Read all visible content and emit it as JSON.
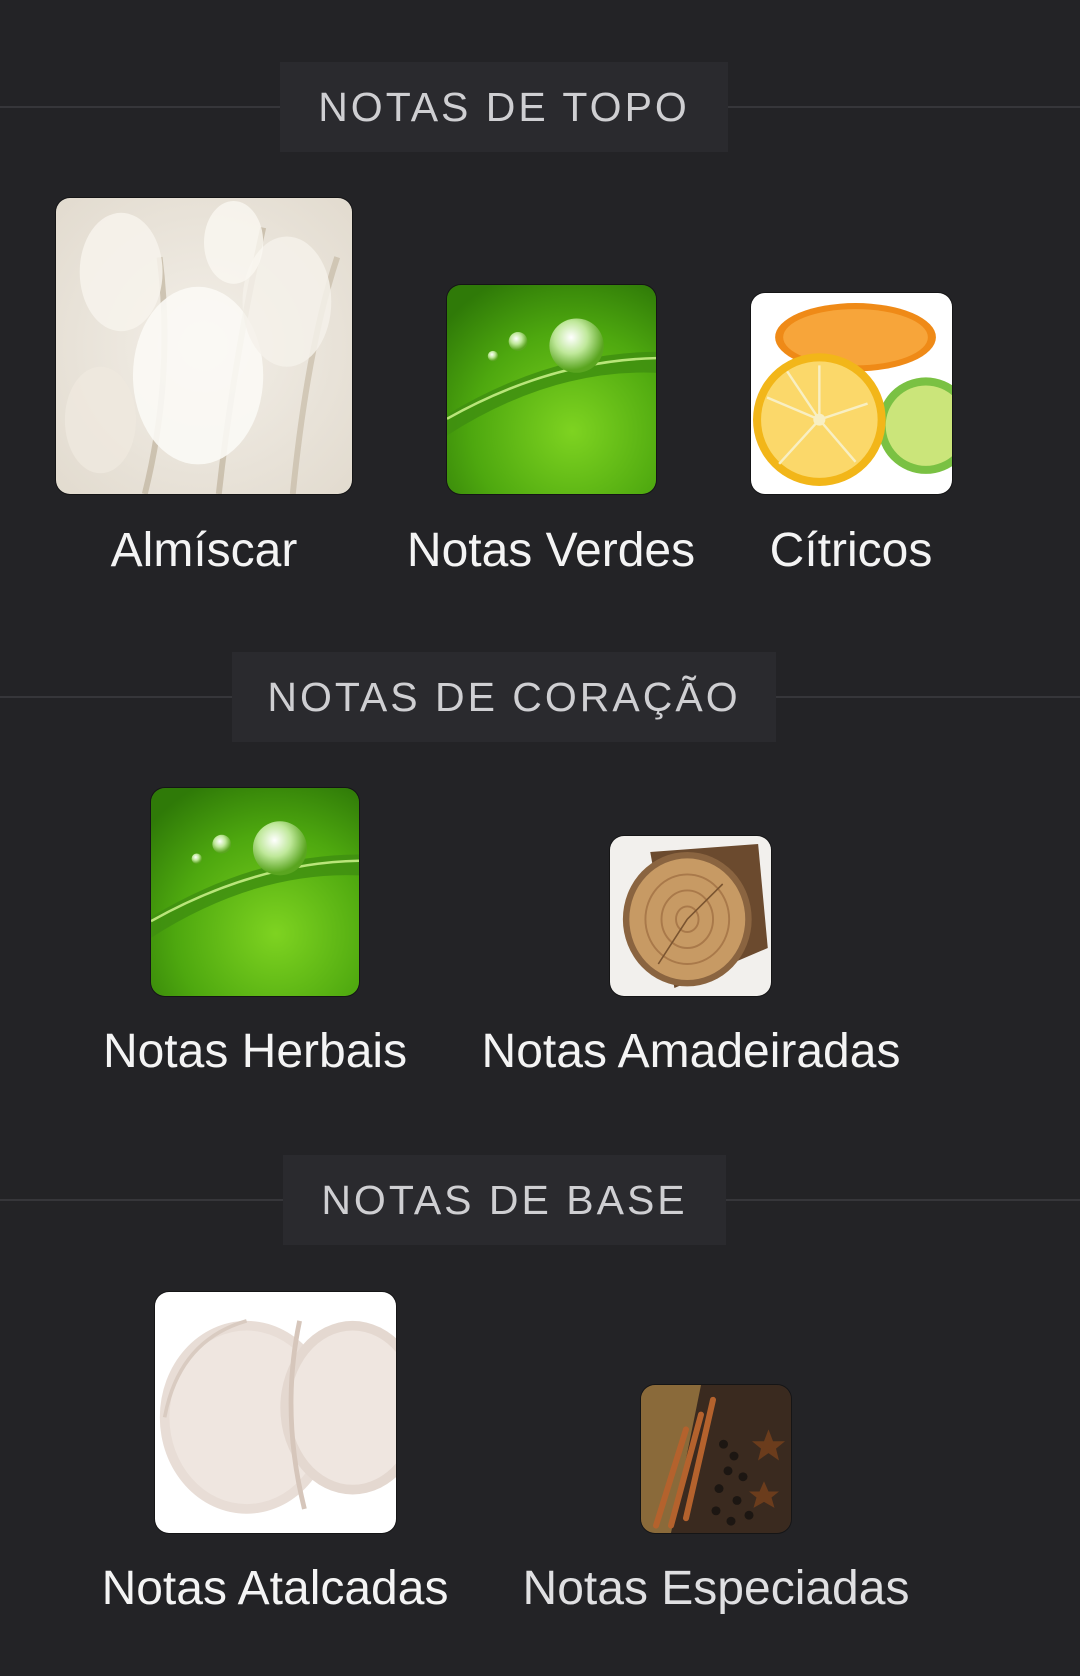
{
  "sections": [
    {
      "title": "NOTAS DE TOPO",
      "notes": [
        {
          "name": "Almíscar",
          "icon": "musk-fluffy-icon"
        },
        {
          "name": "Notas Verdes",
          "icon": "green-leaf-droplet-icon"
        },
        {
          "name": "Cítricos",
          "icon": "citrus-slices-icon"
        }
      ]
    },
    {
      "title": "NOTAS DE CORAÇÃO",
      "notes": [
        {
          "name": "Notas Herbais",
          "icon": "herbal-leaf-droplet-icon"
        },
        {
          "name": "Notas Amadeiradas",
          "icon": "wood-log-icon"
        }
      ]
    },
    {
      "title": "NOTAS DE BASE",
      "notes": [
        {
          "name": "Notas Atalcadas",
          "icon": "powder-icon"
        },
        {
          "name": "Notas Especiadas",
          "icon": "spices-icon"
        }
      ]
    }
  ],
  "colors": {
    "background": "#232326",
    "header_box": "#2a2a2e",
    "rule": "#36363a",
    "header_text": "#cfcfd2",
    "label_text": "#f4f4f4"
  }
}
